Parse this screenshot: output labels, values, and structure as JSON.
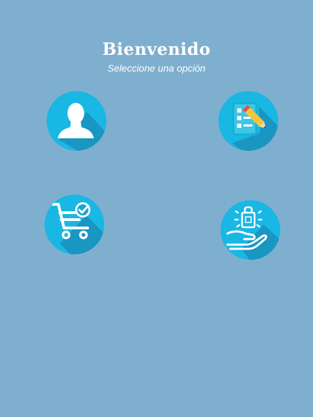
{
  "header": {
    "title": "Bienvenido",
    "subtitle": "Seleccione una opción"
  },
  "options": [
    {
      "icon": "user-icon"
    },
    {
      "icon": "checklist-edit-icon"
    },
    {
      "icon": "shopping-cart-check-icon"
    },
    {
      "icon": "hand-shopping-bag-icon"
    }
  ],
  "colors": {
    "background": "#7fafcf",
    "circle": "#19b7e4",
    "shadow": "#1a6f96",
    "icon": "#ffffff"
  }
}
